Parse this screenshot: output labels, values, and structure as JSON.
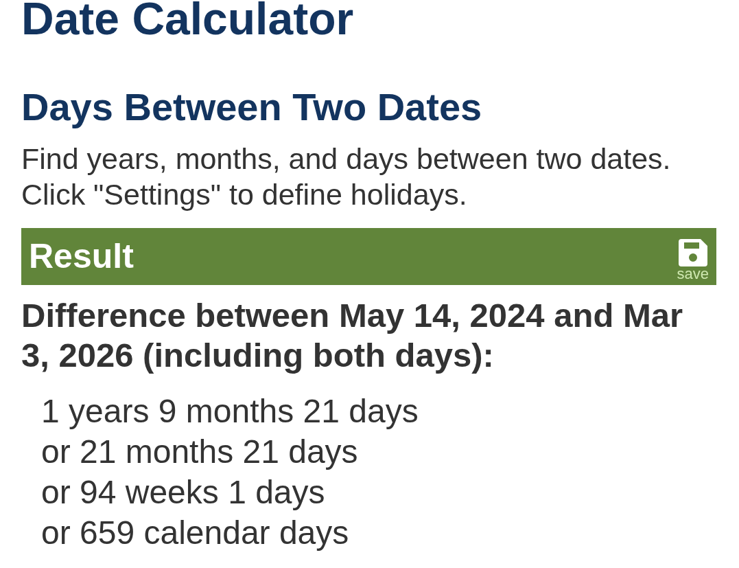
{
  "page": {
    "title": "Date Calculator"
  },
  "calculator": {
    "heading": "Days Between Two Dates",
    "description": [
      "Find years, months, and days between two dates.",
      "Click \"Settings\" to define holidays."
    ]
  },
  "result": {
    "header": "Result",
    "save_label": "save",
    "summary": "Difference between May 14, 2024 and Mar 3, 2026 (including both days):",
    "lines": [
      "1 years 9 months 21 days",
      "or 21 months 21 days",
      "or 94 weeks 1 days",
      "or 659 calendar days"
    ]
  }
}
